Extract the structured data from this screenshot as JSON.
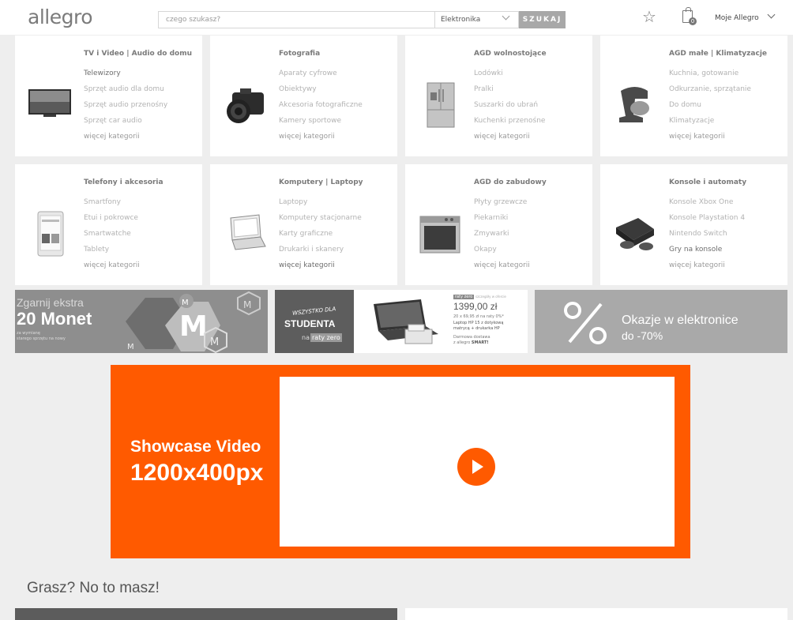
{
  "header": {
    "logo": "allegro",
    "search_placeholder": "czego szukasz?",
    "category": "Elektronika",
    "search_button": "SZUKAJ",
    "cart_count": "0",
    "account": "Moje Allegro"
  },
  "categories": [
    {
      "title": "TV i Video | Audio do domu",
      "links": [
        "Telewizory",
        "Sprzęt audio dla domu",
        "Sprzęt audio przenośny",
        "Sprzęt car audio",
        "więcej kategorii"
      ]
    },
    {
      "title": "Fotografia",
      "links": [
        "Aparaty cyfrowe",
        "Obiektywy",
        "Akcesoria fotograficzne",
        "Kamery sportowe",
        "więcej kategorii"
      ]
    },
    {
      "title": "AGD wolnostojące",
      "links": [
        "Lodówki",
        "Pralki",
        "Suszarki do ubrań",
        "Kuchenki przenośne",
        "więcej kategorii"
      ]
    },
    {
      "title": "AGD małe | Klimatyzacje",
      "links": [
        "Kuchnia, gotowanie",
        "Odkurzanie, sprzątanie",
        "Do domu",
        "Klimatyzacje",
        "więcej kategorii"
      ]
    },
    {
      "title": "Telefony i akcesoria",
      "links": [
        "Smartfony",
        "Etui i pokrowce",
        "Smartwatche",
        "Tablety",
        "więcej kategorii"
      ]
    },
    {
      "title": "Komputery | Laptopy",
      "links": [
        "Laptopy",
        "Komputery stacjonarne",
        "Karty graficzne",
        "Drukarki i skanery",
        "więcej kategorii"
      ]
    },
    {
      "title": "AGD do zabudowy",
      "links": [
        "Płyty grzewcze",
        "Piekarniki",
        "Zmywarki",
        "Okapy",
        "więcej kategorii"
      ]
    },
    {
      "title": "Konsole i automaty",
      "links": [
        "Konsole Xbox One",
        "Konsole Playstation 4",
        "Nintendo Switch",
        "Gry na konsole",
        "więcej kategorii"
      ]
    }
  ],
  "banners": {
    "b1_line1": "Zgarnij ekstra",
    "b1_line2": "20 Monet",
    "b1_small1": "za wymianę",
    "b1_small2": "starego sprzętu na nowy",
    "b2_tag": "WSZYSTKO DLA",
    "b2_title": "STUDENTA",
    "b2_na": "na",
    "b2_raty": "raty zero",
    "b2_badge": "raty zero",
    "b2_badge_note": "szczegóły w ofercie",
    "b2_price": "1399,00 zł",
    "b2_installments": "20 x 69,95 zł na raty 0%*",
    "b2_desc1": "Laptop HP 15 z dotykową",
    "b2_desc2": "matrycą + drukarka HP",
    "b2_delivery1": "Darmowa dostawa",
    "b2_delivery2": "z allegro",
    "b2_smart": "SMART!",
    "b3_line1": "Okazje w elektronice",
    "b3_line2": "do -70%"
  },
  "video": {
    "line1": "Showcase Video",
    "line2": "1200x400px"
  },
  "section_title": "Grasz? No to masz!",
  "colors": {
    "accent": "#ff5a00",
    "banner_gray": "#8a8a8a"
  }
}
